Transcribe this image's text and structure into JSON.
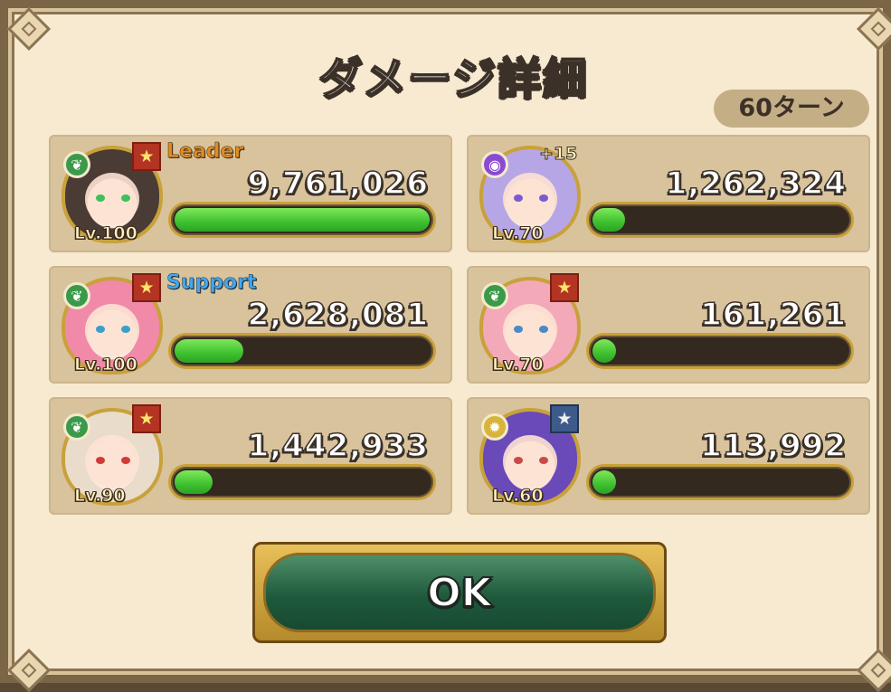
{
  "title": "ダメージ詳細",
  "turn_label": "60ターン",
  "ok_label": "OK",
  "colors": {
    "panel_bg": "#f7ead0",
    "card_bg": "#d8c39d",
    "bar_fill": "#3ec12f",
    "bar_track": "#33291f",
    "button_green": "#1f5a3d",
    "gold_border": "#c9a13a"
  },
  "units": [
    {
      "level": "Lv.100",
      "role": "Leader",
      "damage": "9,761,026",
      "bar_fraction": 1.0,
      "element": "wood",
      "element_icon": "leaf-icon",
      "element_color": "#3a9a4a",
      "rarity_icon": "star-badge-icon",
      "plus": "",
      "hair": "#4a3b34",
      "eyes": "#3ec15a"
    },
    {
      "level": "Lv.70",
      "role": "",
      "damage": "1,262,324",
      "bar_fraction": 0.129,
      "element": "dark",
      "element_icon": "dark-orb-icon",
      "element_color": "#8a4ad1",
      "rarity_icon": "",
      "plus": "+15",
      "hair": "#b7a6e6",
      "eyes": "#7a5ad1"
    },
    {
      "level": "Lv.100",
      "role": "Support",
      "damage": "2,628,081",
      "bar_fraction": 0.269,
      "element": "wood",
      "element_icon": "leaf-icon",
      "element_color": "#3a9a4a",
      "rarity_icon": "star-badge-icon",
      "plus": "",
      "hair": "#f08aa8",
      "eyes": "#3aa0c8"
    },
    {
      "level": "Lv.70",
      "role": "",
      "damage": "161,261",
      "bar_fraction": 0.017,
      "element": "wood",
      "element_icon": "leaf-icon",
      "element_color": "#3a9a4a",
      "rarity_icon": "star-badge-icon",
      "plus": "",
      "hair": "#f3a9b8",
      "eyes": "#4a8ac8"
    },
    {
      "level": "Lv.90",
      "role": "",
      "damage": "1,442,933",
      "bar_fraction": 0.148,
      "element": "wood",
      "element_icon": "leaf-icon",
      "element_color": "#3a9a4a",
      "rarity_icon": "star-badge-icon",
      "plus": "",
      "hair": "#e9dccb",
      "eyes": "#d13a3a"
    },
    {
      "level": "Lv.60",
      "role": "",
      "damage": "113,992",
      "bar_fraction": 0.012,
      "element": "light",
      "element_icon": "light-orb-icon",
      "element_color": "#d8b43a",
      "rarity_icon": "silver-star-badge-icon",
      "plus": "",
      "hair": "#6a4ab8",
      "eyes": "#c84a4a"
    }
  ]
}
